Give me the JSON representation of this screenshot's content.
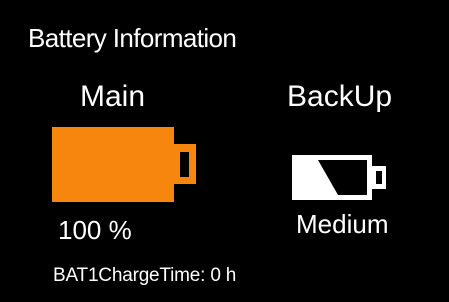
{
  "window": {
    "title": "Battery Information"
  },
  "main_battery": {
    "label": "Main",
    "level_percent": 100,
    "value_text": "100 %",
    "color": "#F7860E"
  },
  "backup_battery": {
    "label": "BackUp",
    "level_text": "Medium",
    "color": "#FFFFFF"
  },
  "charge_time": {
    "label": "BAT1ChargeTime:",
    "value": "0 h"
  }
}
